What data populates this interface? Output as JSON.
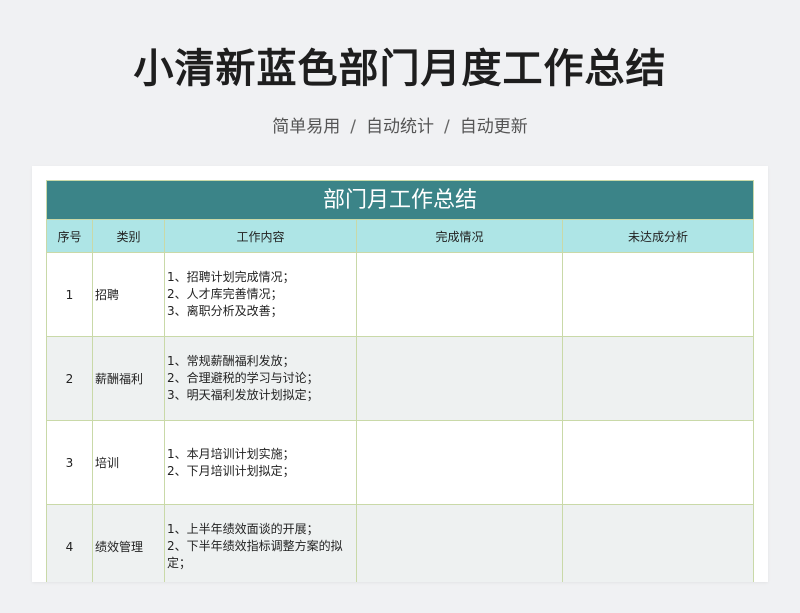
{
  "header": {
    "title": "小清新蓝色部门月度工作总结",
    "tags": [
      "简单易用",
      "自动统计",
      "自动更新"
    ],
    "separator": "/"
  },
  "table": {
    "banner": "部门月工作总结",
    "columns": [
      "序号",
      "类别",
      "工作内容",
      "完成情况",
      "未达成分析"
    ],
    "rows": [
      {
        "no": "1",
        "category": "招聘",
        "items": [
          "1、招聘计划完成情况；",
          "2、人才库完善情况；",
          "3、离职分析及改善；"
        ],
        "done": "",
        "gap": ""
      },
      {
        "no": "2",
        "category": "薪酬福利",
        "items": [
          "1、常规薪酬福利发放；",
          "2、合理避税的学习与讨论；",
          "3、明天福利发放计划拟定；"
        ],
        "done": "",
        "gap": ""
      },
      {
        "no": "3",
        "category": "培训",
        "items": [
          "1、本月培训计划实施；",
          "2、下月培训计划拟定；"
        ],
        "done": "",
        "gap": ""
      },
      {
        "no": "4",
        "category": "绩效管理",
        "items": [
          "1、上半年绩效面谈的开展；",
          "2、下半年绩效指标调整方案的拟",
          "定；"
        ],
        "done": "",
        "gap": ""
      }
    ]
  },
  "colors": {
    "banner_bg": "#3b8488",
    "header_bg": "#aee5e6",
    "alt_row_bg": "#eef1f1",
    "border": "#c9d9a8"
  }
}
